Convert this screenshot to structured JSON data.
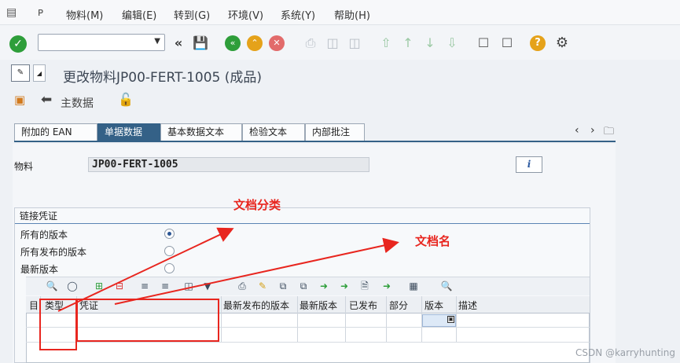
{
  "menu": {
    "items": [
      "物料(M)",
      "编辑(E)",
      "转到(G)",
      "环境(V)",
      "系统(Y)",
      "帮助(H)"
    ]
  },
  "toolbar": {
    "command_value": ""
  },
  "title": {
    "text": "更改物料JP00-FERT-1005 (成品)"
  },
  "app_toolbar": {
    "main_data_label": "主数据"
  },
  "tabs": [
    {
      "label": "附加的 EAN",
      "active": false
    },
    {
      "label": "单据数据",
      "active": true
    },
    {
      "label": "基本数据文本",
      "active": false
    },
    {
      "label": "检验文本",
      "active": false
    },
    {
      "label": "内部批注",
      "active": false
    }
  ],
  "material": {
    "label": "物料",
    "value": "JP00-FERT-1005"
  },
  "link_docs": {
    "group_title": "链接凭证",
    "options": [
      {
        "label": "所有的版本",
        "selected": true
      },
      {
        "label": "所有发布的版本",
        "selected": false
      },
      {
        "label": "最新版本",
        "selected": false
      }
    ]
  },
  "grid": {
    "columns": [
      "类型",
      "凭证",
      "最新发布的版本",
      "最新版本",
      "已发布",
      "部分",
      "版本",
      "描述"
    ],
    "row_marker_header": "目"
  },
  "annotations": {
    "doc_category": "文档分类",
    "doc_name": "文档名"
  },
  "watermark": "CSDN @karryhunting",
  "colors": {
    "accent": "#346187",
    "annotation": "#e8261f"
  }
}
